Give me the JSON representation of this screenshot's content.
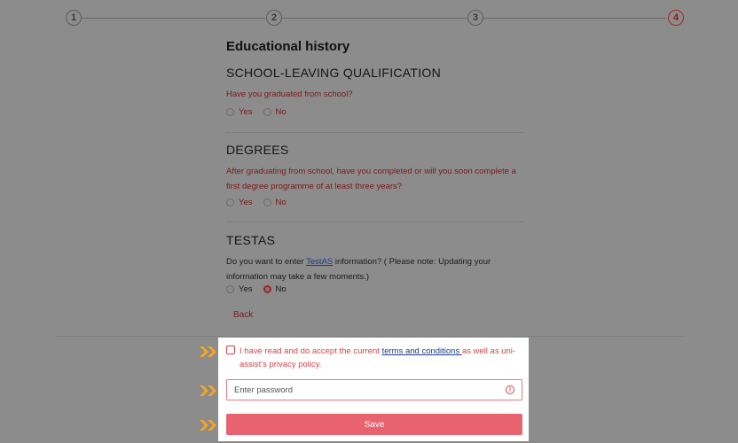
{
  "stepper": {
    "steps": [
      "1",
      "2",
      "3",
      "4"
    ],
    "active_step": "4"
  },
  "form": {
    "title": "Educational history",
    "sections": [
      {
        "heading": "SCHOOL-LEAVING QUALIFICATION",
        "question": "Have you graduated from school?",
        "options": [
          "Yes",
          "No"
        ],
        "selected": null
      },
      {
        "heading": "DEGREES",
        "question": "After graduating from school, have you completed or will you soon complete a first degree programme of at least three years?",
        "options": [
          "Yes",
          "No"
        ],
        "selected": null
      },
      {
        "heading": "TESTAS",
        "question_before": "Do you want to enter ",
        "question_link": "TestAS",
        "question_after": " information? ( Please note: Updating your information may take a few moments.)",
        "options": [
          "Yes",
          "No"
        ],
        "selected": "No"
      }
    ],
    "back_label": "Back"
  },
  "submit_panel": {
    "terms_before": "I have read and do accept the current ",
    "terms_link": "terms and conditions ",
    "terms_after": "as well as uni-assist's privacy policy.",
    "password_placeholder": "Enter password",
    "save_label": "Save"
  },
  "colors": {
    "accent": "#a8202a",
    "error": "#d4424c",
    "save_button": "#e8636f",
    "arrows": "#f5a623",
    "overlay_background": "#8c8c8c"
  }
}
